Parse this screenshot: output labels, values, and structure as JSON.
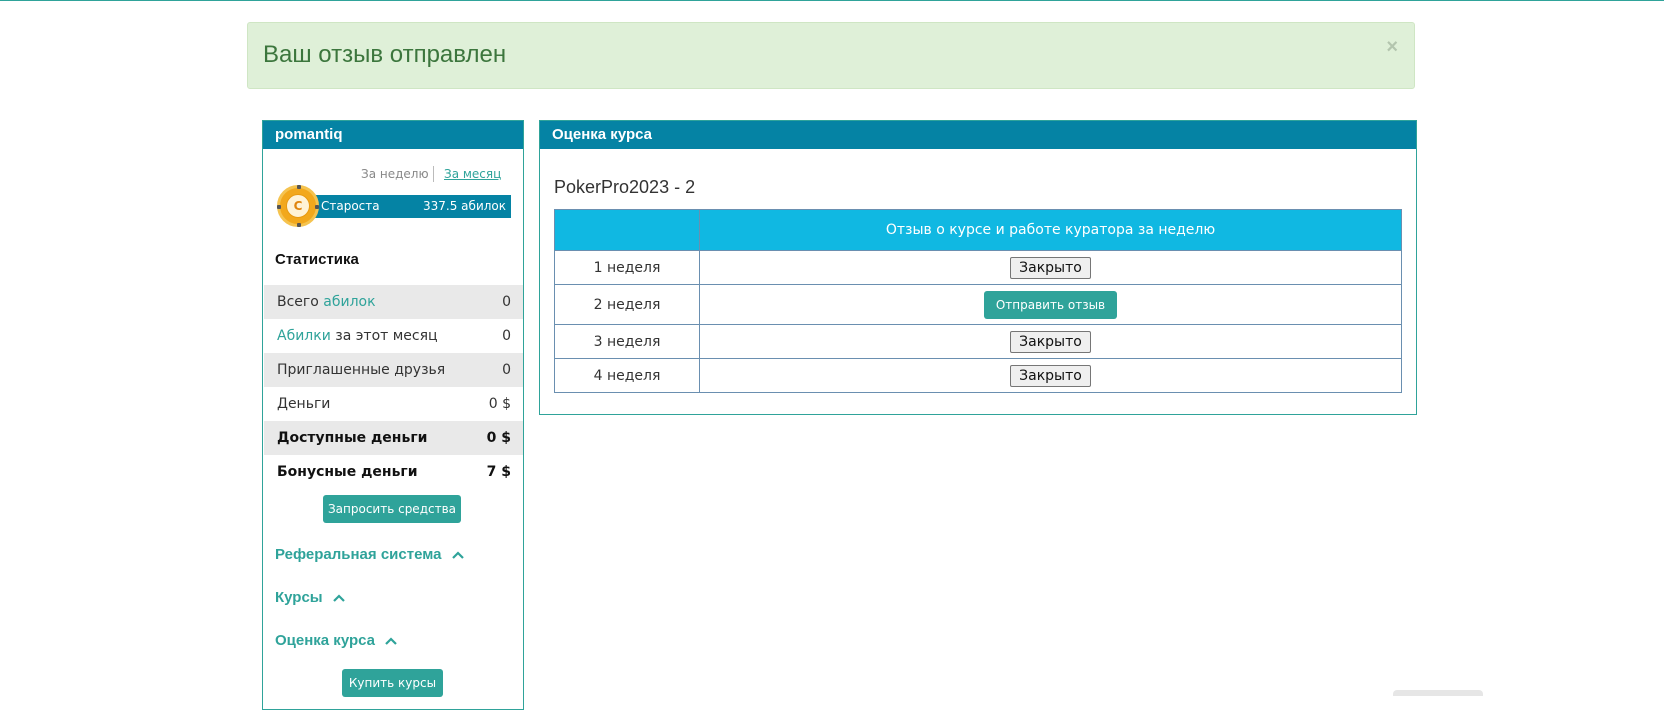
{
  "alert": {
    "message": "Ваш отзыв отправлен",
    "close": "×"
  },
  "sidebar": {
    "username": "pomantiq",
    "period_week": "За неделю",
    "period_month": "За месяц",
    "badge_letter": "С",
    "rank_name": "Староста",
    "rank_points": "337.5 абилок",
    "stats_title": "Статистика",
    "stats": [
      {
        "label_prefix": "Всего ",
        "label_highlight": "абилок",
        "label_suffix": "",
        "value": "0"
      },
      {
        "label_prefix": "",
        "label_highlight": "Абилки",
        "label_suffix": " за этот месяц",
        "value": "0"
      },
      {
        "label_prefix": "Приглашенные друзья",
        "label_highlight": "",
        "label_suffix": "",
        "value": "0"
      },
      {
        "label_prefix": "Деньги",
        "label_highlight": "",
        "label_suffix": "",
        "value": "0 $"
      },
      {
        "label_prefix": "Доступные деньги",
        "label_highlight": "",
        "label_suffix": "",
        "value": "0 $"
      },
      {
        "label_prefix": "Бонусные деньги",
        "label_highlight": "",
        "label_suffix": "",
        "value": "7 $"
      }
    ],
    "request_funds": "Запросить средства",
    "referral": "Реферальная система",
    "courses": "Курсы",
    "course_rating": "Оценка курса",
    "buy_courses": "Купить курсы"
  },
  "main": {
    "header": "Оценка курса",
    "course_title": "PokerPro2023 - 2",
    "table": {
      "col_week": "",
      "col_review": "Отзыв о курсе и работе куратора за неделю",
      "rows": [
        {
          "week": "1 неделя",
          "action": "Закрыто"
        },
        {
          "week": "2 неделя",
          "action": "Отправить отзыв"
        },
        {
          "week": "3 неделя",
          "action": "Закрыто"
        },
        {
          "week": "4 неделя",
          "action": "Закрыто"
        }
      ]
    }
  },
  "icons": {
    "chevron": "chevron-up-icon",
    "close": "close-icon"
  },
  "colors": {
    "accent": "#2fa39a",
    "header": "#0583a4",
    "table_header": "#10b8e2",
    "alert_bg": "#dff0d8"
  }
}
